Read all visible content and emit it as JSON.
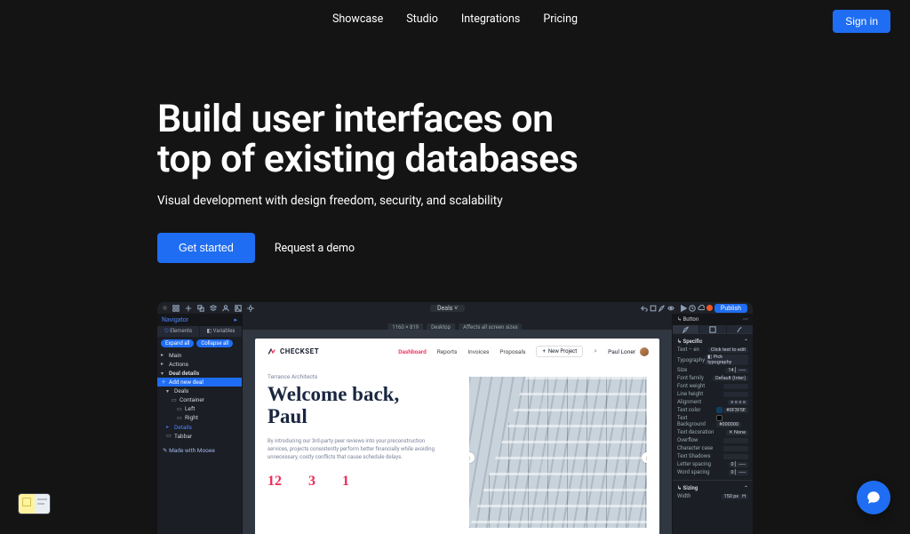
{
  "nav": {
    "items": [
      "Showcase",
      "Studio",
      "Integrations",
      "Pricing"
    ],
    "signin": "Sign in"
  },
  "hero": {
    "title_l1": "Build user interfaces on",
    "title_l2": "top of existing databases",
    "subtitle": "Visual development with design freedom, security, and scalability",
    "cta_primary": "Get started",
    "cta_secondary": "Request a demo"
  },
  "editor": {
    "top_tab": "Deals",
    "publish": "Publish",
    "info": {
      "dims": "1160 × 819",
      "bp": "Desktop",
      "aff": "Affects all screen sizes"
    },
    "left": {
      "header": "Navigator",
      "tabs": [
        "Elements",
        "Variables"
      ],
      "pills": [
        "Expand all",
        "Collapse all"
      ],
      "tree": [
        {
          "label": "Main",
          "icon": "▸"
        },
        {
          "label": "Actions",
          "icon": "▸"
        },
        {
          "label": "Deal details",
          "icon": "▾"
        },
        {
          "label": "Add new deal",
          "icon": "+",
          "sel": true
        },
        {
          "label": "Deals",
          "icon": "▾"
        },
        {
          "label": "Container",
          "icon": "▹"
        },
        {
          "label": "Left",
          "icon": "▹"
        },
        {
          "label": "Right",
          "icon": "▹"
        },
        {
          "label": "Details",
          "icon": "▸"
        },
        {
          "label": "Tabbar",
          "icon": "▹"
        }
      ],
      "bottom": "Made with Mooee"
    },
    "right": {
      "header": "Button",
      "section1": "Specific",
      "rows": {
        "text": {
          "label": "Text – en",
          "value": "Click text to edit"
        },
        "typo": {
          "label": "Typography",
          "value": "Pick typography"
        },
        "size": {
          "label": "Size",
          "value": "14"
        },
        "font": {
          "label": "Font family",
          "value": "Default (Inter)"
        },
        "weight": {
          "label": "Font weight",
          "value": ""
        },
        "lh": {
          "label": "Line height",
          "value": ""
        },
        "align": {
          "label": "Alignment",
          "value": ""
        },
        "tcolor": {
          "label": "Text color",
          "hex": "#0F3F5E"
        },
        "bcolor": {
          "label": "Text Background",
          "hex": "#000000"
        },
        "deco": {
          "label": "Text decoration",
          "value": "None"
        },
        "over": {
          "label": "Overflow",
          "value": ""
        },
        "cc": {
          "label": "Character case",
          "value": ""
        },
        "shadow": {
          "label": "Text Shadows",
          "value": ""
        },
        "ls": {
          "label": "Letter spacing",
          "value": "0"
        },
        "ws": {
          "label": "Word spacing",
          "value": "0"
        }
      },
      "section2": "Sizing",
      "sizing": {
        "w": "Width",
        "wval": "150",
        "h": "H"
      }
    },
    "doc": {
      "brand": "CHECKSET",
      "navlinks": [
        "Dashboard",
        "Reports",
        "Invoices",
        "Proposals"
      ],
      "new_project": "New Project",
      "user": "Paul Loner",
      "eyebrow": "Terrance Architects",
      "welcome_l1": "Welcome back,",
      "welcome_l2": "Paul",
      "para": "By introducing our 3rd-party peer reviews into your preconstruction services, projects consistently perform better financially while avoiding unnecessary, costly conflicts that cause schedule delays.",
      "stats": [
        "12",
        "3",
        "1"
      ]
    }
  },
  "colors": {
    "accent": "#1f6df2"
  }
}
